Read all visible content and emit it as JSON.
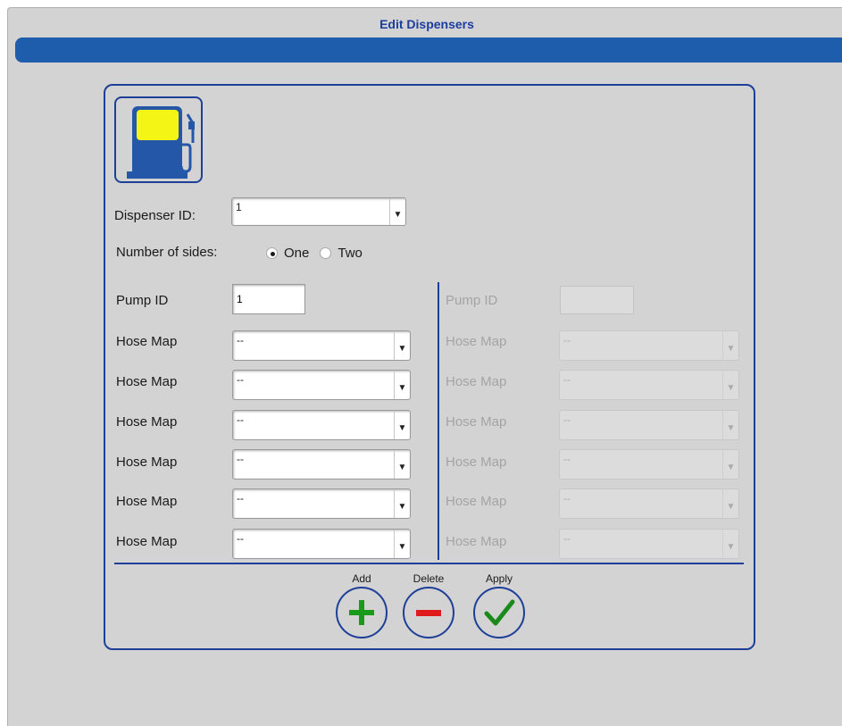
{
  "window": {
    "title": "Edit Dispensers"
  },
  "form": {
    "dispenser_id_label": "Dispenser ID:",
    "dispenser_id_value": "1",
    "sides_label": "Number of sides:",
    "sides_options": [
      "One",
      "Two"
    ],
    "sides_selected": "One",
    "side_one": {
      "pump_id_label": "Pump ID",
      "pump_id_value": "1",
      "hose_map_label": "Hose Map",
      "hose_maps": [
        "--",
        "--",
        "--",
        "--",
        "--",
        "--"
      ]
    },
    "side_two": {
      "enabled": false,
      "pump_id_label": "Pump ID",
      "pump_id_value": "",
      "hose_map_label": "Hose Map",
      "hose_maps": [
        "--",
        "--",
        "--",
        "--",
        "--",
        "--"
      ]
    }
  },
  "actions": {
    "add_label": "Add",
    "delete_label": "Delete",
    "apply_label": "Apply"
  },
  "icons": {
    "dispenser": "fuel-pump-icon",
    "add": "plus-icon",
    "delete": "minus-icon",
    "apply": "check-icon",
    "dropdown": "dropdown-arrow-icon"
  },
  "colors": {
    "accent": "#1d5dab",
    "border_blue": "#1d3f97",
    "title_text": "#1b3d9e",
    "background": "#d3d3d3",
    "add_green": "#1a9a1a",
    "delete_red": "#e01b1b",
    "apply_green": "#1a8a1a",
    "pump_screen": "#f4f415"
  }
}
